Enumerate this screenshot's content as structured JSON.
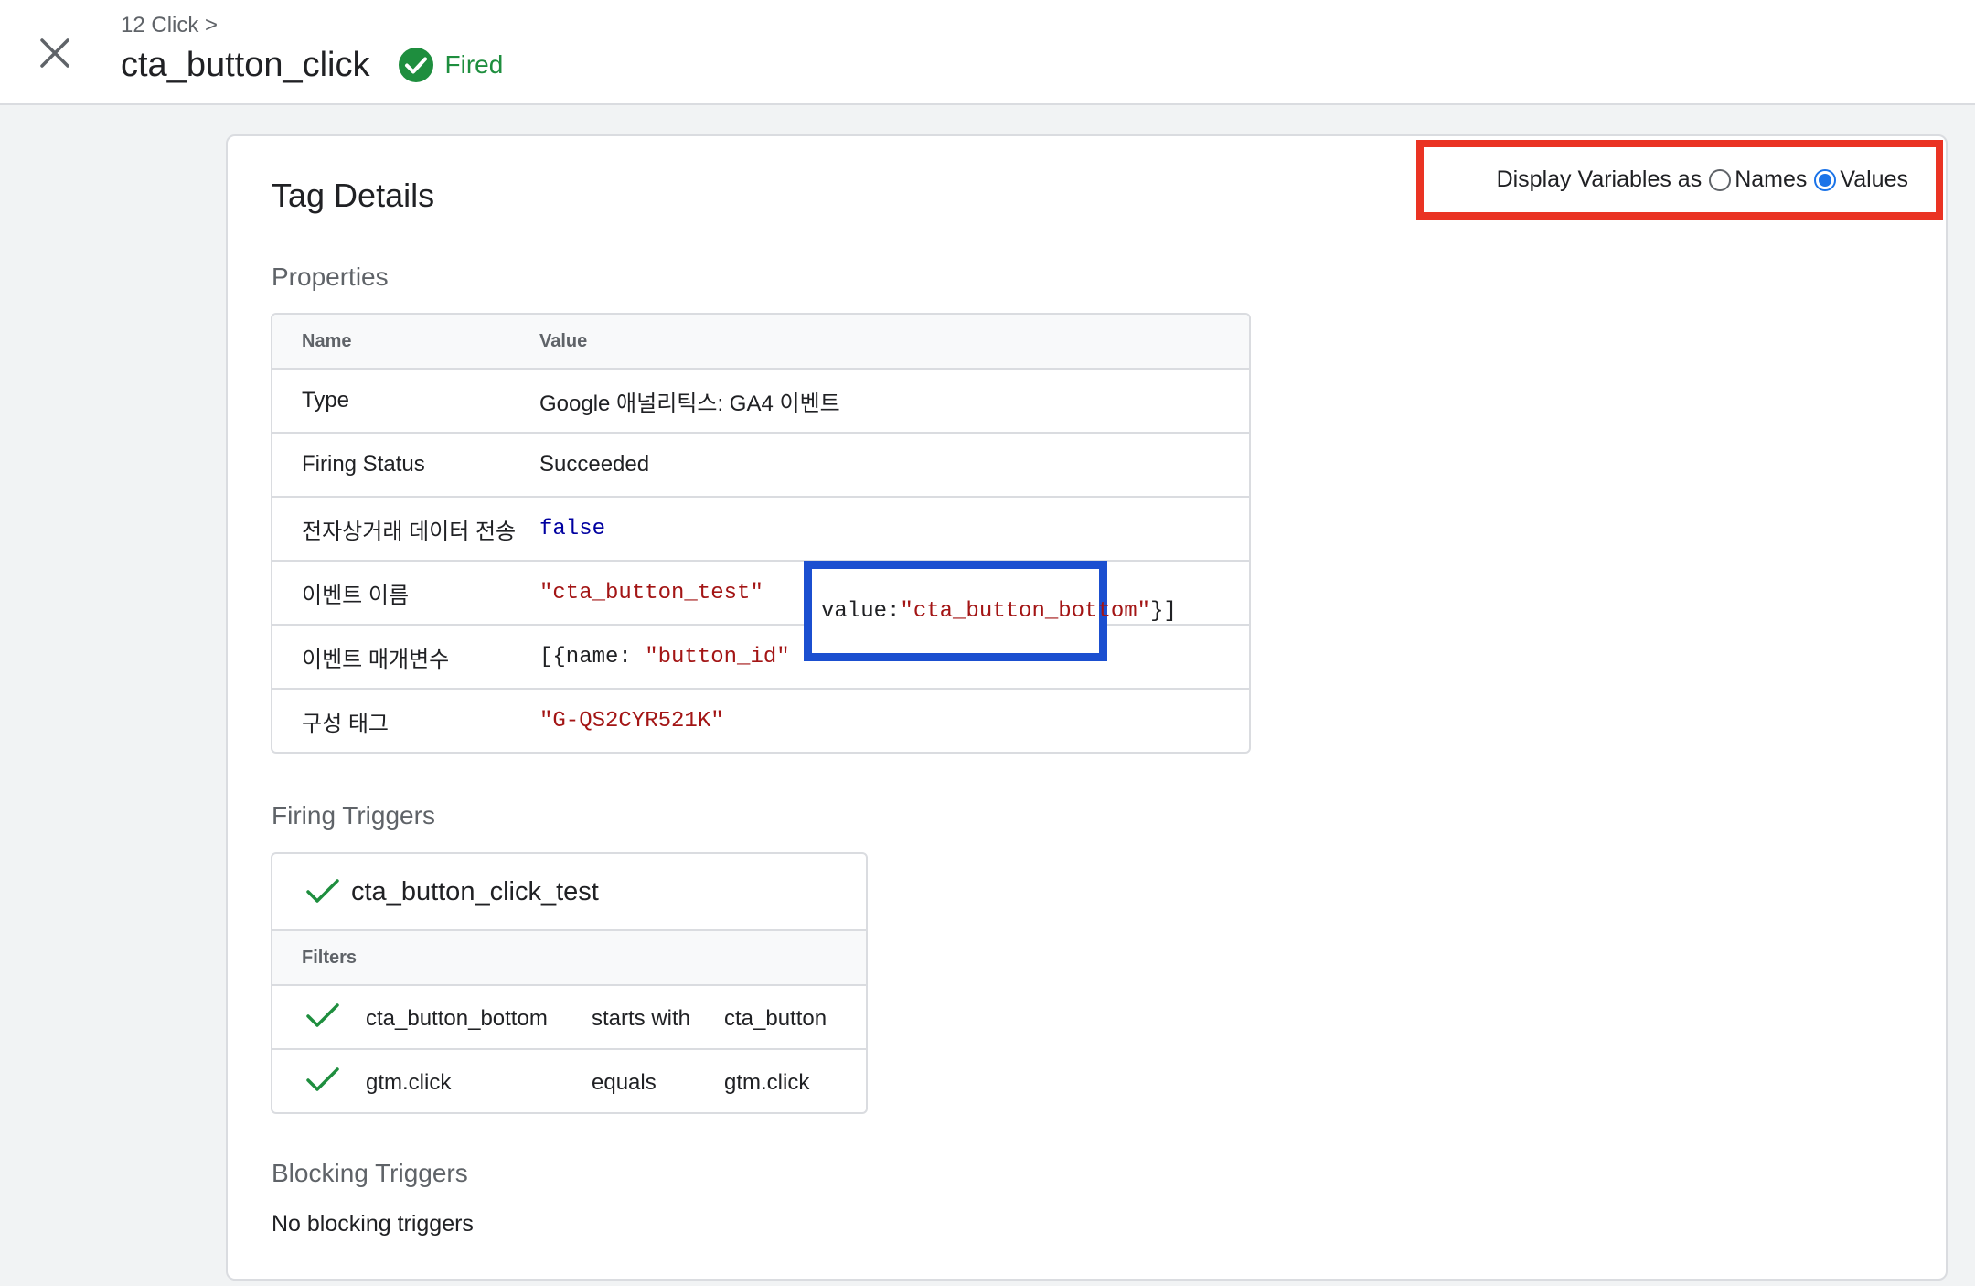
{
  "header": {
    "breadcrumb": "12 Click >",
    "title": "cta_button_click",
    "status": "Fired"
  },
  "card": {
    "title": "Tag Details",
    "display_toggle": {
      "label": "Display Variables as",
      "options": [
        "Names",
        "Values"
      ],
      "selected": "Values"
    },
    "properties": {
      "section_label": "Properties",
      "columns": [
        "Name",
        "Value"
      ],
      "rows": [
        {
          "name": "Type",
          "value": "Google 애널리틱스: GA4 이벤트"
        },
        {
          "name": "Firing Status",
          "value": "Succeeded"
        },
        {
          "name": "전자상거래 데이터 전송",
          "value": "false"
        },
        {
          "name": "이벤트 이름",
          "value": "\"cta_button_test\""
        },
        {
          "name": "이벤트 매개변수",
          "value_prefix": "[{name: ",
          "value_str1": "\"button_id\"",
          "value_mid": "value: ",
          "value_str2": "\"cta_button_bottom\"",
          "value_suffix": "}]"
        },
        {
          "name": "구성 태그",
          "value": "\"G-QS2CYR521K\""
        }
      ]
    },
    "firing_triggers": {
      "section_label": "Firing Triggers",
      "trigger_name": "cta_button_click_test",
      "filters_label": "Filters",
      "filters": [
        {
          "variable": "cta_button_bottom",
          "operator": "starts with",
          "value": "cta_button"
        },
        {
          "variable": "gtm.click",
          "operator": "equals",
          "value": "gtm.click"
        }
      ]
    },
    "blocking_triggers": {
      "section_label": "Blocking Triggers",
      "empty_text": "No blocking triggers"
    }
  },
  "colors": {
    "success": "#1e8e3e",
    "highlight_red": "#ea3323",
    "highlight_blue": "#1b4fd0",
    "radio_selected": "#1a73e8",
    "string_value": "#a31515",
    "keyword_value": "#0000a0"
  },
  "icons": [
    "close-icon",
    "check-circle-icon",
    "check-icon"
  ]
}
